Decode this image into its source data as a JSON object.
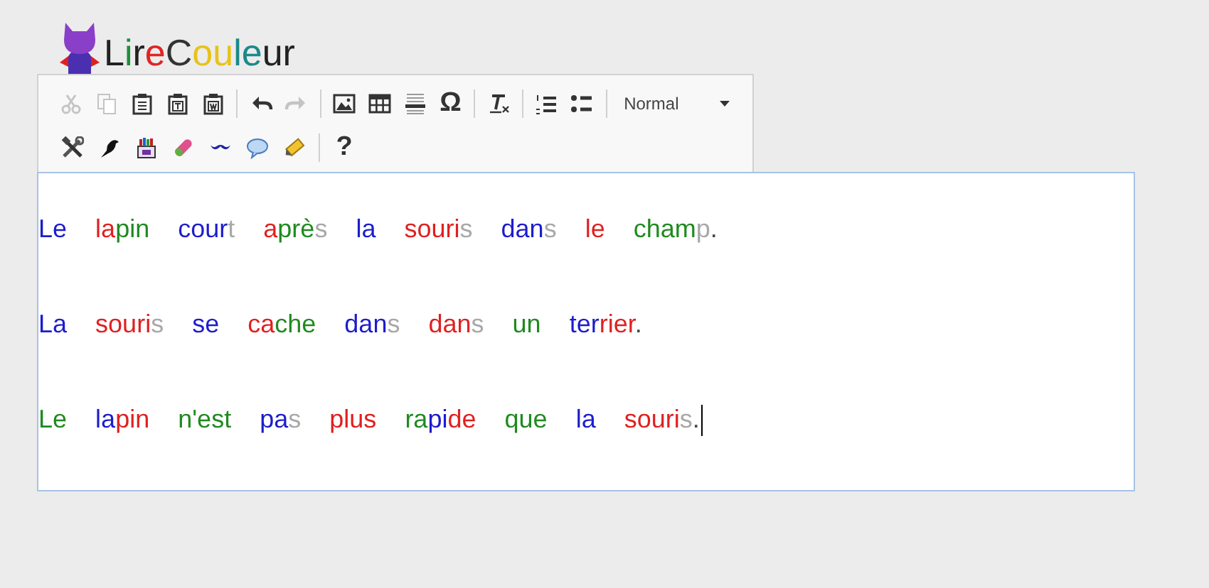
{
  "logo": {
    "segments": [
      {
        "text": "L",
        "color": "#222222"
      },
      {
        "text": "i",
        "color": "#1f8f3a"
      },
      {
        "text": "r",
        "color": "#222222"
      },
      {
        "text": "e",
        "color": "#e02424"
      },
      {
        "text": "C",
        "color": "#333333"
      },
      {
        "text": "ou",
        "color": "#e8c21a"
      },
      {
        "text": "l",
        "color": "#1a8a8a"
      },
      {
        "text": "e",
        "color": "#1a8a8a"
      },
      {
        "text": "ur",
        "color": "#222222"
      }
    ]
  },
  "toolbar": {
    "rows": [
      {
        "groups": [
          {
            "buttons": [
              {
                "kind": "cut",
                "disabled": true
              },
              {
                "kind": "copy",
                "disabled": true
              },
              {
                "kind": "paste",
                "disabled": false
              },
              {
                "kind": "paste-text",
                "disabled": false
              },
              {
                "kind": "paste-word",
                "disabled": false
              }
            ]
          },
          {
            "buttons": [
              {
                "kind": "undo",
                "disabled": false
              },
              {
                "kind": "redo",
                "disabled": true
              }
            ]
          },
          {
            "buttons": [
              {
                "kind": "image",
                "disabled": false
              },
              {
                "kind": "table",
                "disabled": false
              },
              {
                "kind": "horizontal-rule",
                "disabled": false
              },
              {
                "kind": "special-char",
                "label": "Ω",
                "disabled": false
              }
            ]
          },
          {
            "buttons": [
              {
                "kind": "remove-format",
                "disabled": false
              }
            ]
          },
          {
            "buttons": [
              {
                "kind": "numbered-list",
                "disabled": false
              },
              {
                "kind": "bulleted-list",
                "disabled": false
              }
            ]
          },
          {
            "buttons": [
              {
                "kind": "format",
                "label": "Normal",
                "disabled": false
              }
            ]
          }
        ]
      },
      {
        "groups": [
          {
            "buttons": [
              {
                "kind": "tools",
                "disabled": false
              },
              {
                "kind": "bird",
                "disabled": false
              },
              {
                "kind": "crayons",
                "disabled": false
              },
              {
                "kind": "eraser",
                "disabled": false
              },
              {
                "kind": "mustache",
                "disabled": false
              },
              {
                "kind": "speech-bubble",
                "disabled": false
              },
              {
                "kind": "highlighter",
                "disabled": false
              }
            ]
          },
          {
            "buttons": [
              {
                "kind": "help",
                "label": "?",
                "disabled": false
              }
            ]
          }
        ]
      }
    ]
  },
  "editor": {
    "caret": true,
    "paragraphs": [
      {
        "words": [
          [
            {
              "text": "Le",
              "color": "#1c1ccc"
            }
          ],
          [
            {
              "text": "la",
              "color": "#e02020"
            },
            {
              "text": "pin",
              "color": "#1f8a1f"
            }
          ],
          [
            {
              "text": "cour",
              "color": "#1c1ccc"
            },
            {
              "text": "t",
              "color": "#a8a8a8"
            }
          ],
          [
            {
              "text": "a",
              "color": "#e02020"
            },
            {
              "text": "prè",
              "color": "#1f8a1f"
            },
            {
              "text": "s",
              "color": "#a8a8a8"
            }
          ],
          [
            {
              "text": "la",
              "color": "#1c1ccc"
            }
          ],
          [
            {
              "text": "souri",
              "color": "#e02020"
            },
            {
              "text": "s",
              "color": "#a8a8a8"
            }
          ],
          [
            {
              "text": "dan",
              "color": "#1c1ccc"
            },
            {
              "text": "s",
              "color": "#a8a8a8"
            }
          ],
          [
            {
              "text": "le",
              "color": "#e02020"
            }
          ],
          [
            {
              "text": "cham",
              "color": "#1f8a1f"
            },
            {
              "text": "p",
              "color": "#a8a8a8"
            },
            {
              "text": ".",
              "color": "#444444"
            }
          ]
        ]
      },
      {
        "words": [
          [
            {
              "text": "La",
              "color": "#1c1ccc"
            }
          ],
          [
            {
              "text": "souri",
              "color": "#e02020"
            },
            {
              "text": "s",
              "color": "#a8a8a8"
            }
          ],
          [
            {
              "text": "se",
              "color": "#1c1ccc"
            }
          ],
          [
            {
              "text": "ca",
              "color": "#e02020"
            },
            {
              "text": "che",
              "color": "#1f8a1f"
            }
          ],
          [
            {
              "text": "dan",
              "color": "#1c1ccc"
            },
            {
              "text": "s",
              "color": "#a8a8a8"
            }
          ],
          [
            {
              "text": "dan",
              "color": "#e02020"
            },
            {
              "text": "s",
              "color": "#a8a8a8"
            }
          ],
          [
            {
              "text": "un",
              "color": "#1f8a1f"
            }
          ],
          [
            {
              "text": "ter",
              "color": "#1c1ccc"
            },
            {
              "text": "rier",
              "color": "#e02020"
            },
            {
              "text": ".",
              "color": "#444444"
            }
          ]
        ]
      },
      {
        "words": [
          [
            {
              "text": "Le",
              "color": "#1f8a1f"
            }
          ],
          [
            {
              "text": "la",
              "color": "#1c1ccc"
            },
            {
              "text": "pin",
              "color": "#e02020"
            }
          ],
          [
            {
              "text": "n'est",
              "color": "#1f8a1f"
            }
          ],
          [
            {
              "text": "pa",
              "color": "#1c1ccc"
            },
            {
              "text": "s",
              "color": "#a8a8a8"
            }
          ],
          [
            {
              "text": "plus",
              "color": "#e02020"
            }
          ],
          [
            {
              "text": "ra",
              "color": "#1f8a1f"
            },
            {
              "text": "pi",
              "color": "#1c1ccc"
            },
            {
              "text": "de",
              "color": "#e02020"
            }
          ],
          [
            {
              "text": "que",
              "color": "#1f8a1f"
            }
          ],
          [
            {
              "text": "la",
              "color": "#1c1ccc"
            }
          ],
          [
            {
              "text": "souri",
              "color": "#e02020"
            },
            {
              "text": "s",
              "color": "#a8a8a8"
            },
            {
              "text": ".",
              "color": "#444444"
            }
          ]
        ]
      }
    ]
  }
}
